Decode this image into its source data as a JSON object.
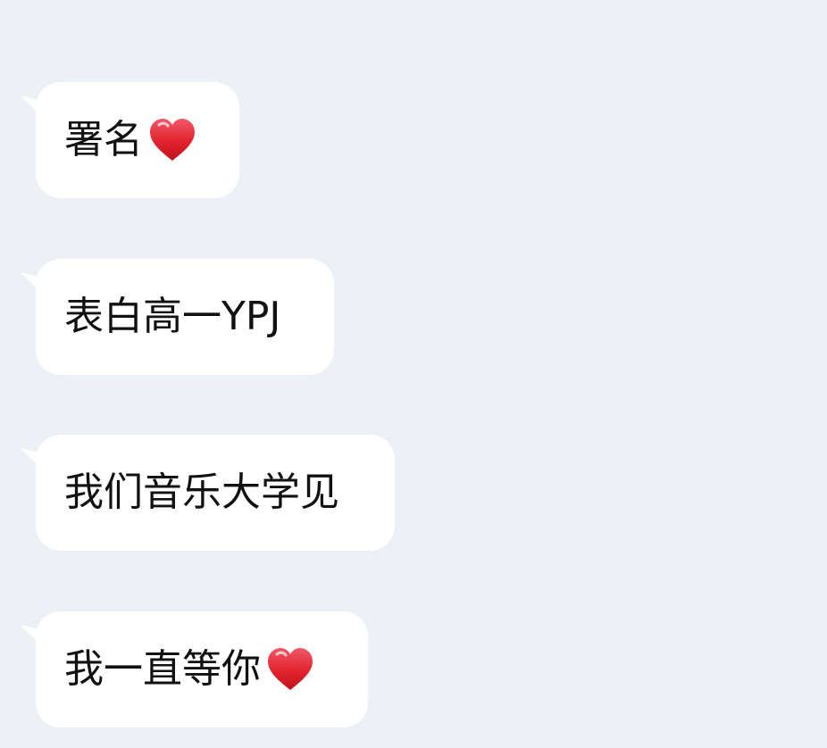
{
  "chat": {
    "messages": [
      {
        "text": "署名",
        "emoji": "heart-icon"
      },
      {
        "text": "表白高一YPJ",
        "emoji": ""
      },
      {
        "text": "我们音乐大学见",
        "emoji": ""
      },
      {
        "text": "我一直等你",
        "emoji": "heart-icon"
      }
    ]
  },
  "colors": {
    "background": "#edf1f6",
    "bubble": "#ffffff",
    "text": "#111111",
    "heart": "#e2232d"
  }
}
